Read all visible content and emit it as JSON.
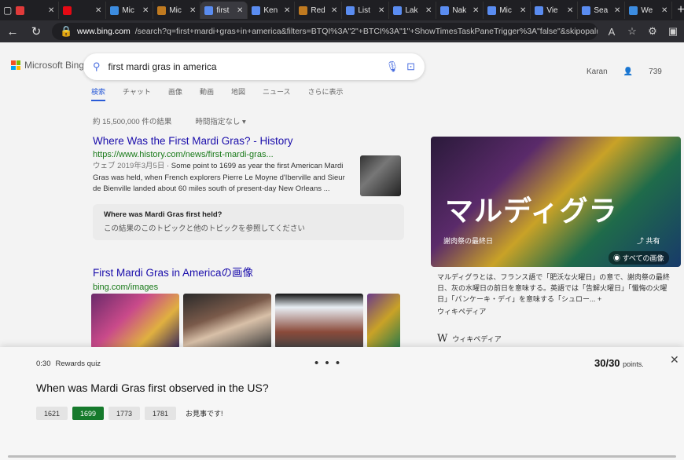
{
  "browser": {
    "tabs": [
      {
        "label": "",
        "color": "#e03a3a"
      },
      {
        "label": "",
        "color": "#e50914"
      },
      {
        "label": "Mic",
        "color": "#3c8ce0"
      },
      {
        "label": "Mic",
        "color": "#c07a20"
      },
      {
        "label": "first",
        "color": "#5a8cf0",
        "active": true
      },
      {
        "label": "Ken",
        "color": "#5a8cf0"
      },
      {
        "label": "Red",
        "color": "#c07a20"
      },
      {
        "label": "List",
        "color": "#5a8cf0"
      },
      {
        "label": "Lak",
        "color": "#5a8cf0"
      },
      {
        "label": "Nak",
        "color": "#5a8cf0"
      },
      {
        "label": "Mic",
        "color": "#5a8cf0"
      },
      {
        "label": "Vie",
        "color": "#5a8cf0"
      },
      {
        "label": "Sea",
        "color": "#5a8cf0"
      },
      {
        "label": "We",
        "color": "#3c8ce0"
      }
    ],
    "url_host": "www.bing.com",
    "url_path": "/search?q=first+mardi+gras+in+america&filters=BTQI%3A\"2\"+BTCI%3A\"1\"+ShowTimesTaskPaneTrigger%3A\"false\"&skipopalnative=true..."
  },
  "bing": {
    "logo_text": "Microsoft Bing",
    "query": "first mardi gras in america",
    "user_name": "Karan",
    "points": "739",
    "vertical_tabs": [
      "検索",
      "チャット",
      "画像",
      "動画",
      "地図",
      "ニュース",
      "さらに表示"
    ],
    "result_count": "約 15,500,000 件の結果",
    "time_filter": "時間指定なし ▾",
    "result1": {
      "title": "Where Was the First Mardi Gras? - History",
      "url": "https://www.history.com/news/first-mardi-gras...",
      "date": "ウェブ 2019年3月5日",
      "snippet": " · Some point to 1699 as year the first American Mardi Gras was held, when French explorers Pierre Le Moyne d'Iberville and Sieur de Bienville landed about 60 miles south of present-day New Orleans ..."
    },
    "paa": {
      "question": "Where was Mardi Gras first held?",
      "subtext": "この結果のこのトピックと他のトピックを参照してください"
    },
    "images": {
      "title": "First Mardi Gras in Americaの画像",
      "url": "bing.com/images"
    },
    "knowledge_panel": {
      "title": "マルディグラ",
      "subtitle": "謝肉祭の最終日",
      "share": "共有",
      "all_images": "すべての画像",
      "description": "マルディグラとは、フランス語で「肥沃な火曜日」の意で、謝肉祭の最終日、灰の水曜日の前日を意味する。英語では「告解火曜日」「懺悔の火曜日」「パンケーキ・デイ」を意味する「シュロー... +",
      "source": "ウィキペディア",
      "wiki_label": "ウィキペディア"
    }
  },
  "quiz": {
    "time": "0:30",
    "label": "Rewards quiz",
    "dots": "• • •",
    "score": "30/30",
    "score_label": "points.",
    "question": "When was Mardi Gras first observed in the US?",
    "options": [
      "1621",
      "1699",
      "1773",
      "1781"
    ],
    "correct_index": 1,
    "feedback": "お見事です!",
    "correct_color": "#167a2c"
  }
}
